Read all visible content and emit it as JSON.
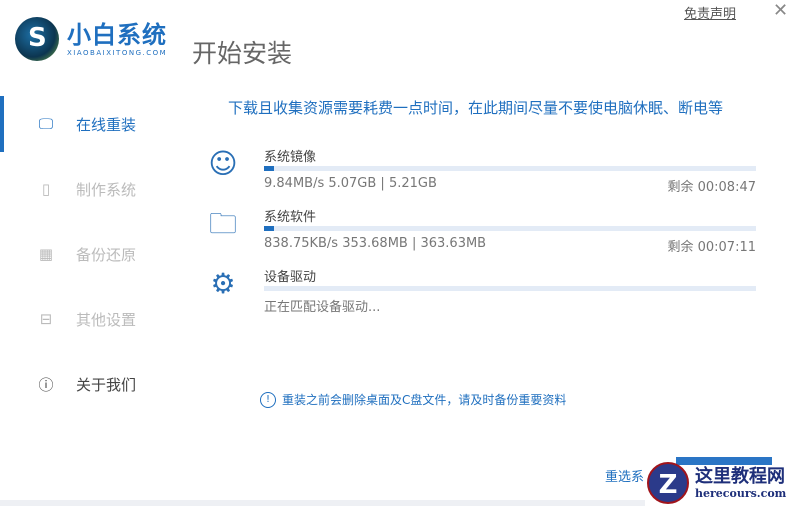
{
  "app": {
    "logo_cn": "小白系统",
    "logo_en": "XIAOBAIXITONG.COM",
    "title": "开始安装",
    "disclaimer": "免责声明",
    "close": "✕"
  },
  "sidebar": {
    "items": [
      {
        "label": "在线重装",
        "icon": "monitor-icon",
        "glyph": "🖵"
      },
      {
        "label": "制作系统",
        "icon": "usb-icon",
        "glyph": "▯"
      },
      {
        "label": "备份还原",
        "icon": "backup-icon",
        "glyph": "▦"
      },
      {
        "label": "其他设置",
        "icon": "briefcase-icon",
        "glyph": "⊟"
      },
      {
        "label": "关于我们",
        "icon": "info-icon",
        "glyph": "ⓘ"
      }
    ]
  },
  "main": {
    "notice": "下载且收集资源需要耗费一点时间，在此期间尽量不要使电脑休眠、断电等",
    "downloads": [
      {
        "name": "系统镜像",
        "stat": "9.84MB/s 5.07GB | 5.21GB",
        "remain": "剩余 00:08:47",
        "progress_percent": 2,
        "icon": "face-icon",
        "glyph": "☺"
      },
      {
        "name": "系统软件",
        "stat": "838.75KB/s 353.68MB | 363.63MB",
        "remain": "剩余 00:07:11",
        "progress_percent": 2,
        "icon": "folder-icon",
        "glyph": "🗀"
      },
      {
        "name": "设备驱动",
        "stat": "正在匹配设备驱动...",
        "remain": "",
        "progress_percent": 0,
        "icon": "gear-icon",
        "glyph": "⚙"
      }
    ],
    "warning": "重装之前会删除桌面及C盘文件，请及时备份重要资料",
    "warning_icon": "!",
    "reselect": "重选系"
  },
  "watermark": {
    "letter": "Z",
    "cn": "这里教程网",
    "en": "herecours.com"
  }
}
